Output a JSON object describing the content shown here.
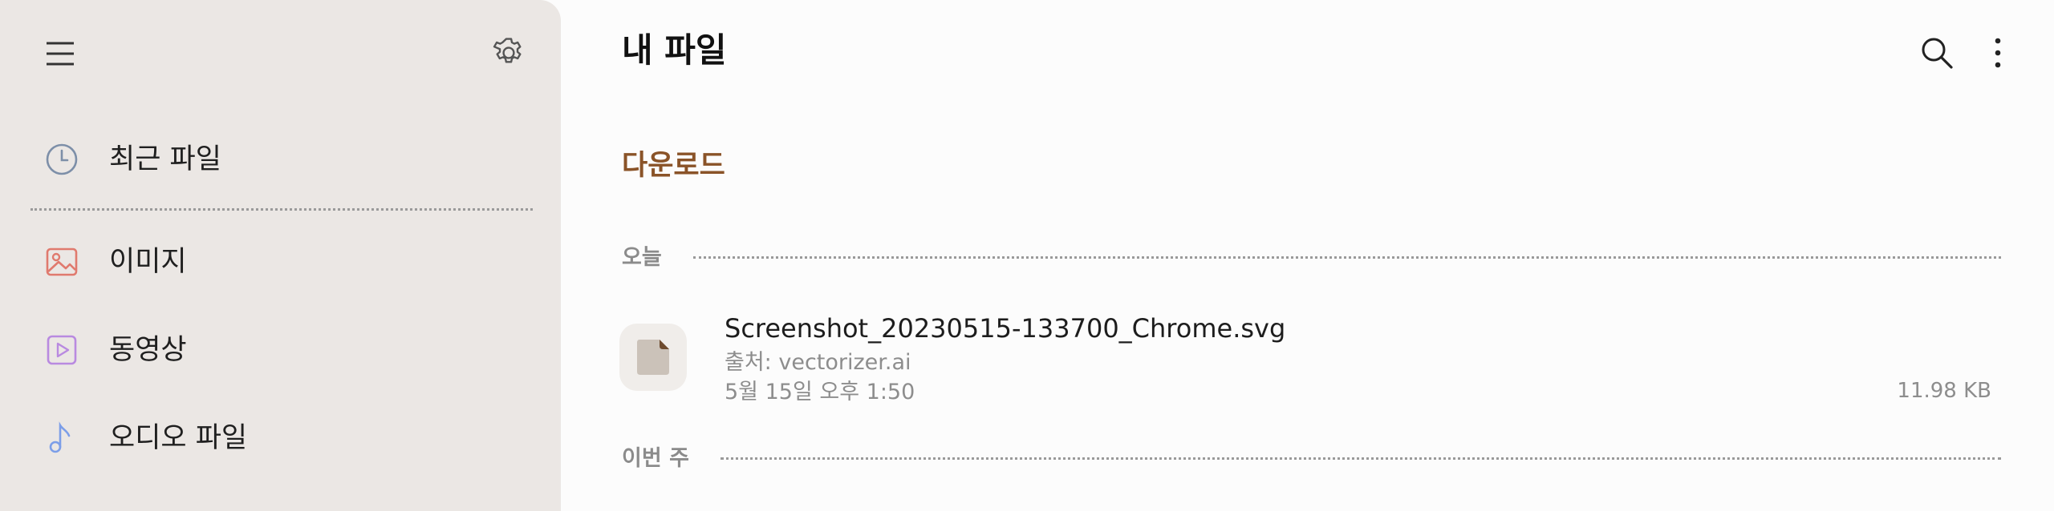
{
  "sidebar": {
    "items": [
      {
        "label": "최근 파일",
        "icon": "clock-icon",
        "color": "#7d8fa8"
      },
      {
        "label": "이미지",
        "icon": "image-icon",
        "color": "#e07a6e"
      },
      {
        "label": "동영상",
        "icon": "video-icon",
        "color": "#b98ae0"
      },
      {
        "label": "오디오 파일",
        "icon": "music-note-icon",
        "color": "#7c9ee8"
      }
    ]
  },
  "header": {
    "title": "내 파일"
  },
  "main": {
    "breadcrumb": "다운로드",
    "groups": [
      {
        "label": "오늘",
        "files": [
          {
            "name": "Screenshot_20230515-133700_Chrome.svg",
            "source": "출처: vectorizer.ai",
            "date": "5월 15일 오후 1:50",
            "size": "11.98 KB"
          }
        ]
      },
      {
        "label": "이번 주",
        "files": []
      }
    ]
  },
  "colors": {
    "accent": "#8a5328",
    "sidebar_bg": "#ebe7e4"
  }
}
